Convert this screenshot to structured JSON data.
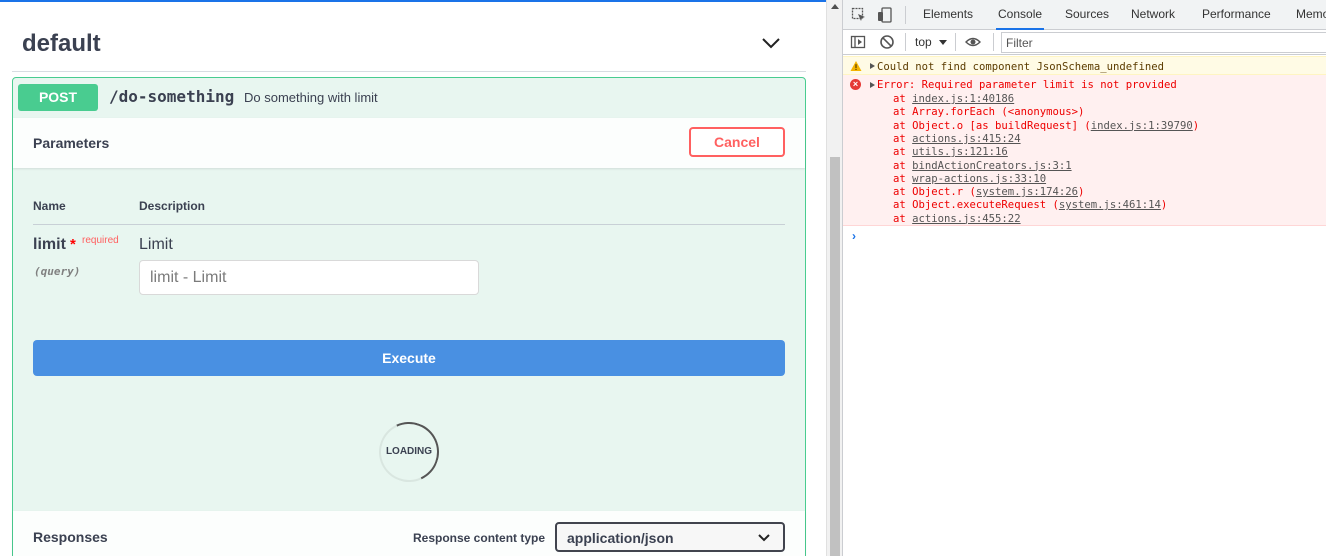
{
  "tag": {
    "title": "default"
  },
  "operation": {
    "method": "POST",
    "path": "/do-something",
    "summary": "Do something with limit",
    "section_title": "Parameters",
    "cancel_label": "Cancel",
    "columns": {
      "name": "Name",
      "description": "Description"
    },
    "param": {
      "name": "limit",
      "required_star": "*",
      "required_label": "required",
      "location": "(query)",
      "description": "Limit",
      "placeholder": "limit - Limit"
    },
    "execute_label": "Execute",
    "loading_label": "LOADING",
    "responses": {
      "title": "Responses",
      "content_type_label": "Response content type",
      "content_type_value": "application/json"
    }
  },
  "devtools": {
    "tabs": [
      "Elements",
      "Console",
      "Sources",
      "Network",
      "Performance",
      "Memo"
    ],
    "active_tab": "Console",
    "context": "top",
    "filter_placeholder": "Filter",
    "warning": "Could not find component JsonSchema_undefined",
    "error": "Error: Required parameter limit is not provided",
    "stack": [
      {
        "prefix": "at ",
        "fn": "",
        "link": "index.js:1:40186",
        "suffix": ""
      },
      {
        "prefix": "at ",
        "fn": "Array.forEach (<anonymous>)",
        "link": "",
        "suffix": ""
      },
      {
        "prefix": "at ",
        "fn": "Object.o [as buildRequest] (",
        "link": "index.js:1:39790",
        "suffix": ")"
      },
      {
        "prefix": "at ",
        "fn": "",
        "link": "actions.js:415:24",
        "suffix": ""
      },
      {
        "prefix": "at ",
        "fn": "",
        "link": "utils.js:121:16",
        "suffix": ""
      },
      {
        "prefix": "at ",
        "fn": "",
        "link": "bindActionCreators.js:3:1",
        "suffix": ""
      },
      {
        "prefix": "at ",
        "fn": "",
        "link": "wrap-actions.js:33:10",
        "suffix": ""
      },
      {
        "prefix": "at ",
        "fn": "Object.r (",
        "link": "system.js:174:26",
        "suffix": ")"
      },
      {
        "prefix": "at ",
        "fn": "Object.executeRequest (",
        "link": "system.js:461:14",
        "suffix": ")"
      },
      {
        "prefix": "at ",
        "fn": "",
        "link": "actions.js:455:22",
        "suffix": ""
      }
    ],
    "prompt": "›"
  },
  "colors": {
    "post": "#49cc90",
    "execute": "#4990e2",
    "cancel": "#ff6060",
    "error_text": "#e00000",
    "devtools_accent": "#1a73e8"
  }
}
